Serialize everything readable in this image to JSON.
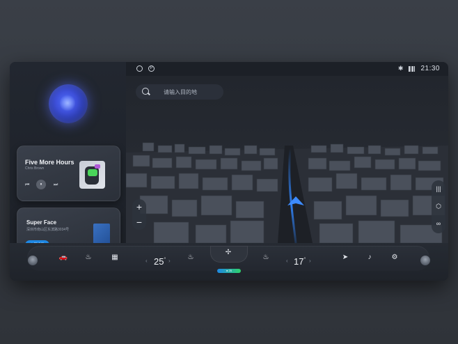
{
  "status": {
    "left_icons": [
      "circle-icon",
      "p-icon"
    ],
    "p_glyph": "P",
    "bluetooth": "✱",
    "time": "21:30"
  },
  "music": {
    "title": "Five More Hours",
    "artist": "Chris Brown",
    "prev": "⏮",
    "play": "⏸",
    "next": "⏭"
  },
  "face": {
    "title": "Super Face",
    "subtitle": "深圳市南山区东滨路3034号",
    "button": "立即设置"
  },
  "map": {
    "search_placeholder": "请输入目的地",
    "zoom_in": "+",
    "zoom_out": "−",
    "tools": [
      "|||",
      "⬡",
      "∞"
    ]
  },
  "dock": {
    "car_icon": "🚗",
    "defrost_icon": "♨",
    "rear_defrost_icon": "▦",
    "left_temp": "25",
    "right_temp": "17",
    "degree": "°",
    "seat_heat_left": "♨",
    "seat_heat_right": "♨",
    "fan_icon": "✢",
    "fan_badge": "● 25",
    "nav_icon": "➤",
    "music_icon": "♪",
    "settings_icon": "⚙",
    "left_chev": "‹",
    "right_chev": "›"
  }
}
